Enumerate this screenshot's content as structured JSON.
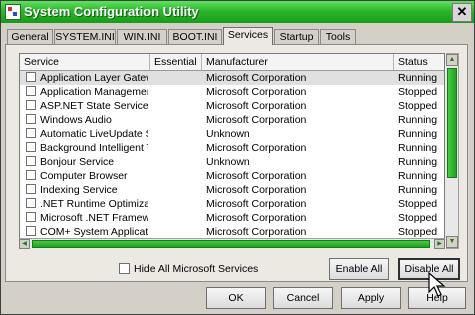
{
  "window": {
    "title": "System Configuration Utility",
    "close_label": "✕",
    "colors": {
      "titlebar": "#2cb52c",
      "scrollbar": "#33bb33",
      "face": "#d4d0c8"
    }
  },
  "tabs": [
    {
      "label": "General"
    },
    {
      "label": "SYSTEM.INI"
    },
    {
      "label": "WIN.INI"
    },
    {
      "label": "BOOT.INI"
    },
    {
      "label": "Services",
      "active": true
    },
    {
      "label": "Startup"
    },
    {
      "label": "Tools"
    }
  ],
  "table": {
    "columns": [
      "Service",
      "Essential",
      "Manufacturer",
      "Status"
    ],
    "rows": [
      {
        "service": "Application Layer Gatew...",
        "essential": "",
        "manufacturer": "Microsoft Corporation",
        "status": "Running",
        "selected": true
      },
      {
        "service": "Application Management",
        "essential": "",
        "manufacturer": "Microsoft Corporation",
        "status": "Stopped"
      },
      {
        "service": "ASP.NET State Service",
        "essential": "",
        "manufacturer": "Microsoft Corporation",
        "status": "Stopped"
      },
      {
        "service": "Windows Audio",
        "essential": "",
        "manufacturer": "Microsoft Corporation",
        "status": "Running"
      },
      {
        "service": "Automatic LiveUpdate Sc...",
        "essential": "",
        "manufacturer": "Unknown",
        "status": "Running"
      },
      {
        "service": "Background Intelligent T...",
        "essential": "",
        "manufacturer": "Microsoft Corporation",
        "status": "Running"
      },
      {
        "service": "Bonjour Service",
        "essential": "",
        "manufacturer": "Unknown",
        "status": "Running"
      },
      {
        "service": "Computer Browser",
        "essential": "",
        "manufacturer": "Microsoft Corporation",
        "status": "Running"
      },
      {
        "service": "Indexing Service",
        "essential": "",
        "manufacturer": "Microsoft Corporation",
        "status": "Running"
      },
      {
        "service": ".NET Runtime Optimizati...",
        "essential": "",
        "manufacturer": "Microsoft Corporation",
        "status": "Stopped"
      },
      {
        "service": "Microsoft .NET Framewo...",
        "essential": "",
        "manufacturer": "Microsoft Corporation",
        "status": "Stopped"
      },
      {
        "service": "COM+ System Application",
        "essential": "",
        "manufacturer": "Microsoft Corporation",
        "status": "Stopped"
      }
    ]
  },
  "scrollbars": {
    "vertical": {
      "up_icon": "▲",
      "down_icon": "▼"
    },
    "horizontal": {
      "left_icon": "◀",
      "right_icon": "▶"
    }
  },
  "hide_ms_label": "Hide All Microsoft Services",
  "buttons": {
    "enable_all": "Enable All",
    "disable_all": "Disable All",
    "ok": "OK",
    "cancel": "Cancel",
    "apply": "Apply",
    "help": "Help"
  },
  "icons": {
    "app": "system-config-icon",
    "close": "close-icon",
    "cursor": "mouse-pointer-icon"
  }
}
